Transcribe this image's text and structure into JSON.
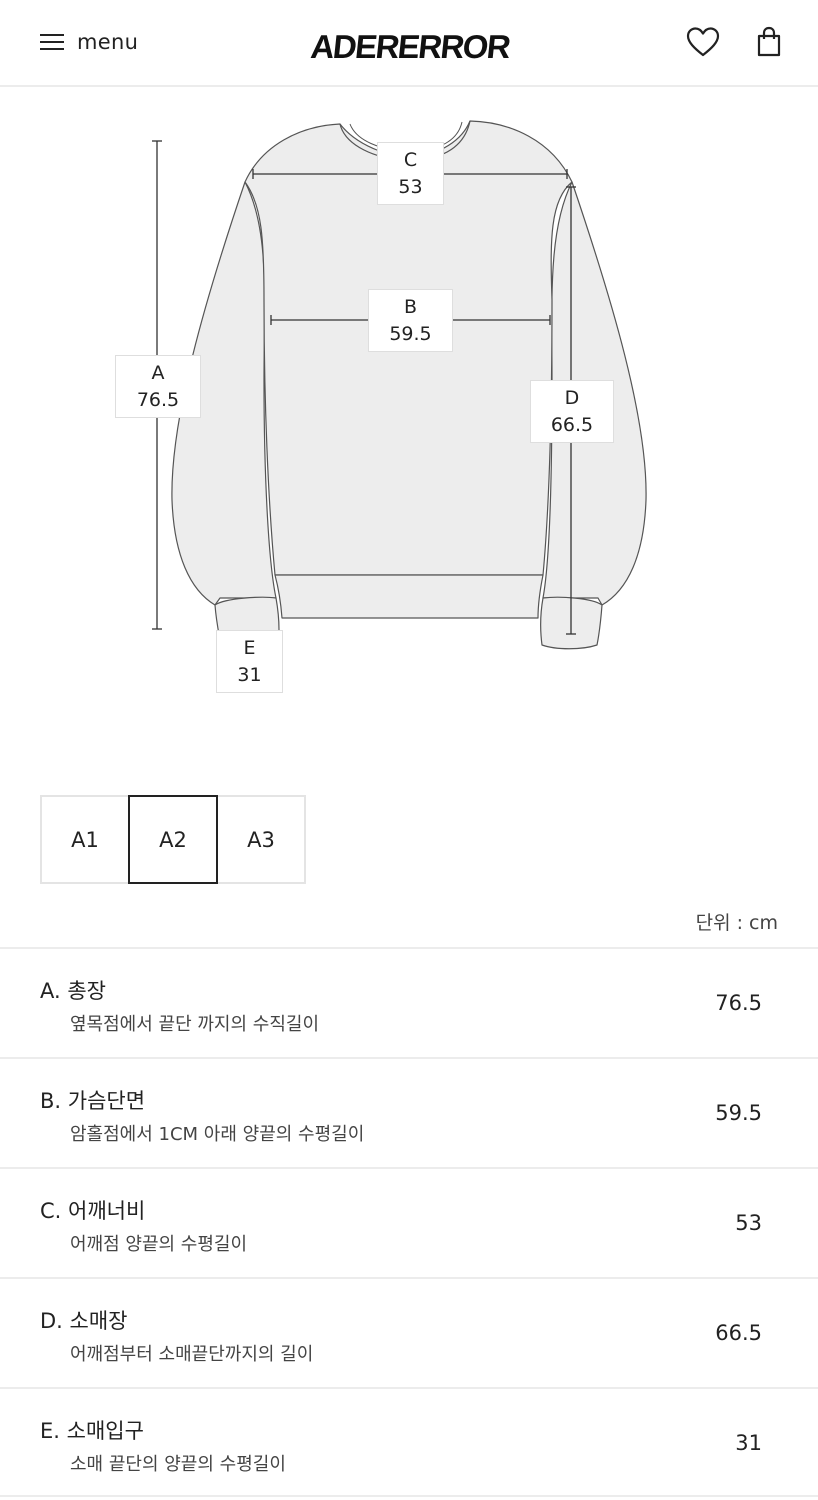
{
  "header": {
    "menu_label": "menu",
    "logo": "ADERERROR",
    "icons": [
      "hamburger-icon",
      "heart-icon",
      "bag-icon"
    ]
  },
  "diagram": {
    "labels": [
      {
        "letter": "A",
        "value": "76.5"
      },
      {
        "letter": "B",
        "value": "59.5"
      },
      {
        "letter": "C",
        "value": "53"
      },
      {
        "letter": "D",
        "value": "66.5"
      },
      {
        "letter": "E",
        "value": "31"
      }
    ]
  },
  "sizes": {
    "options": [
      "A1",
      "A2",
      "A3"
    ],
    "selected": "A2"
  },
  "unit_label": "단위 : cm",
  "measurements": [
    {
      "title": "A. 총장",
      "desc": "옆목점에서 끝단 까지의 수직길이",
      "value": "76.5"
    },
    {
      "title": "B. 가슴단면",
      "desc": "암홀점에서 1CM 아래 양끝의 수평길이",
      "value": "59.5"
    },
    {
      "title": "C. 어깨너비",
      "desc": "어깨점 양끝의 수평길이",
      "value": "53"
    },
    {
      "title": "D. 소매장",
      "desc": "어깨점부터 소매끝단까지의 길이",
      "value": "66.5"
    },
    {
      "title": "E. 소매입구",
      "desc": "소매 끝단의 양끝의 수평길이",
      "value": "31"
    }
  ],
  "colors": {
    "garment_fill": "#ededed",
    "outline": "#555555",
    "selected_border": "#222222",
    "divider": "#ececec"
  }
}
